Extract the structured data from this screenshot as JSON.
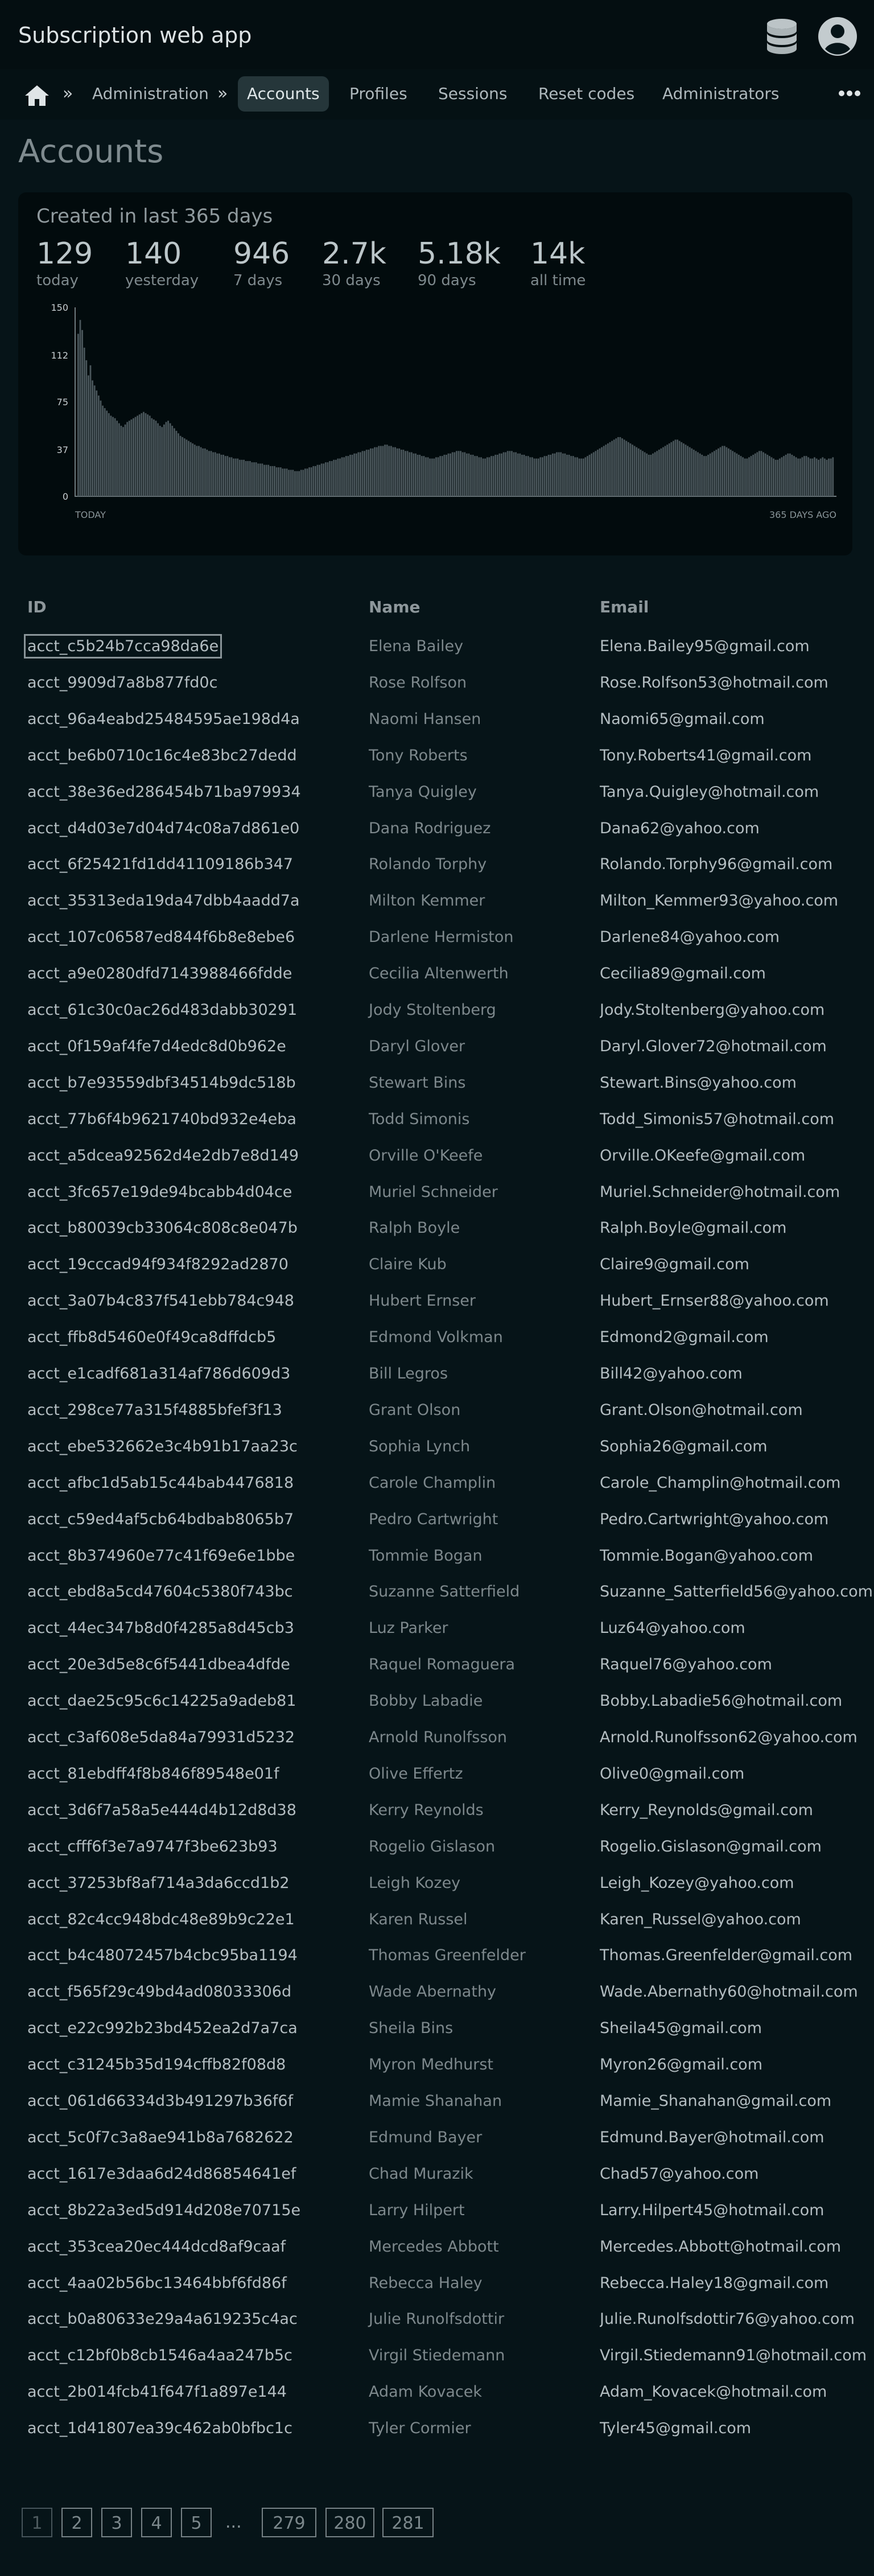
{
  "app": {
    "title": "Subscription web app"
  },
  "nav": {
    "separator": "»",
    "breadcrumb_admin": "Administration",
    "items": [
      {
        "label": "Accounts",
        "active": true
      },
      {
        "label": "Profiles"
      },
      {
        "label": "Sessions"
      },
      {
        "label": "Reset codes"
      },
      {
        "label": "Administrators"
      }
    ]
  },
  "page": {
    "title": "Accounts"
  },
  "stats": {
    "heading": "Created in last 365 days",
    "items": [
      {
        "value": "129",
        "label": "today"
      },
      {
        "value": "140",
        "label": "yesterday"
      },
      {
        "value": "946",
        "label": "7 days"
      },
      {
        "value": "2.7k",
        "label": "30 days"
      },
      {
        "value": "5.18k",
        "label": "90 days"
      },
      {
        "value": "14k",
        "label": "all time"
      }
    ]
  },
  "chart_data": {
    "type": "bar",
    "title": "",
    "x_start_label": "TODAY",
    "x_end_label": "365 DAYS AGO",
    "ylim": [
      0,
      150
    ],
    "y_ticks": [
      "150",
      "112",
      "75",
      "37",
      "0"
    ],
    "values": [
      129,
      140,
      132,
      118,
      108,
      96,
      104,
      92,
      88,
      84,
      80,
      76,
      72,
      70,
      68,
      66,
      64,
      63,
      62,
      60,
      58,
      56,
      55,
      57,
      59,
      60,
      61,
      62,
      63,
      64,
      65,
      66,
      67,
      66,
      65,
      64,
      62,
      61,
      60,
      58,
      56,
      55,
      57,
      59,
      60,
      58,
      56,
      54,
      52,
      50,
      48,
      47,
      46,
      45,
      44,
      43,
      42,
      41,
      40,
      40,
      39,
      38,
      38,
      37,
      36,
      36,
      35,
      35,
      34,
      34,
      33,
      33,
      32,
      32,
      31,
      31,
      30,
      30,
      30,
      29,
      29,
      29,
      28,
      28,
      28,
      27,
      27,
      27,
      26,
      26,
      26,
      25,
      25,
      25,
      24,
      24,
      24,
      23,
      23,
      23,
      22,
      22,
      22,
      21,
      21,
      21,
      20,
      20,
      20,
      21,
      21,
      22,
      22,
      23,
      23,
      24,
      24,
      25,
      25,
      26,
      26,
      27,
      27,
      28,
      28,
      29,
      29,
      30,
      30,
      31,
      31,
      32,
      32,
      33,
      33,
      34,
      34,
      35,
      35,
      36,
      36,
      37,
      37,
      38,
      38,
      39,
      39,
      40,
      40,
      40,
      41,
      41,
      40,
      40,
      39,
      39,
      38,
      38,
      37,
      37,
      36,
      36,
      35,
      35,
      34,
      34,
      33,
      33,
      32,
      32,
      31,
      31,
      30,
      30,
      30,
      31,
      31,
      32,
      32,
      33,
      33,
      34,
      34,
      35,
      35,
      36,
      36,
      36,
      35,
      35,
      34,
      34,
      33,
      33,
      32,
      32,
      31,
      31,
      30,
      30,
      31,
      31,
      32,
      32,
      33,
      33,
      34,
      34,
      35,
      35,
      36,
      36,
      36,
      35,
      35,
      34,
      34,
      33,
      33,
      32,
      32,
      31,
      31,
      30,
      30,
      30,
      31,
      31,
      32,
      32,
      33,
      33,
      34,
      34,
      35,
      35,
      35,
      34,
      34,
      33,
      33,
      32,
      32,
      31,
      31,
      30,
      30,
      30,
      31,
      32,
      33,
      34,
      35,
      36,
      37,
      38,
      39,
      40,
      41,
      42,
      43,
      44,
      45,
      46,
      47,
      47,
      46,
      45,
      44,
      43,
      42,
      41,
      40,
      39,
      38,
      37,
      36,
      35,
      34,
      33,
      33,
      34,
      35,
      36,
      37,
      38,
      39,
      40,
      41,
      42,
      43,
      44,
      45,
      45,
      44,
      43,
      42,
      41,
      40,
      39,
      38,
      37,
      36,
      35,
      34,
      33,
      32,
      32,
      33,
      34,
      35,
      36,
      37,
      38,
      39,
      40,
      40,
      39,
      38,
      37,
      36,
      35,
      34,
      33,
      32,
      31,
      30,
      30,
      31,
      32,
      33,
      34,
      35,
      36,
      36,
      35,
      34,
      33,
      32,
      31,
      30,
      29,
      29,
      30,
      31,
      32,
      33,
      34,
      34,
      33,
      32,
      31,
      30,
      30,
      31,
      32,
      32,
      31,
      30,
      30,
      31,
      30,
      29,
      30,
      31,
      30,
      29,
      30,
      30,
      31
    ]
  },
  "table": {
    "headers": {
      "id": "ID",
      "name": "Name",
      "email": "Email"
    },
    "rows": [
      {
        "id": "acct_c5b24b7cca98da6e",
        "name": "Elena Bailey",
        "email": "Elena.Bailey95@gmail.com"
      },
      {
        "id": "acct_9909d7a8b877fd0c",
        "name": "Rose Rolfson",
        "email": "Rose.Rolfson53@hotmail.com"
      },
      {
        "id": "acct_96a4eabd25484595ae198d4a",
        "name": "Naomi Hansen",
        "email": "Naomi65@gmail.com"
      },
      {
        "id": "acct_be6b0710c16c4e83bc27dedd",
        "name": "Tony Roberts",
        "email": "Tony.Roberts41@gmail.com"
      },
      {
        "id": "acct_38e36ed286454b71ba979934",
        "name": "Tanya Quigley",
        "email": "Tanya.Quigley@hotmail.com"
      },
      {
        "id": "acct_d4d03e7d04d74c08a7d861e0",
        "name": "Dana Rodriguez",
        "email": "Dana62@yahoo.com"
      },
      {
        "id": "acct_6f25421fd1dd41109186b347",
        "name": "Rolando Torphy",
        "email": "Rolando.Torphy96@gmail.com"
      },
      {
        "id": "acct_35313eda19da47dbb4aadd7a",
        "name": "Milton Kemmer",
        "email": "Milton_Kemmer93@yahoo.com"
      },
      {
        "id": "acct_107c06587ed844f6b8e8ebe6",
        "name": "Darlene Hermiston",
        "email": "Darlene84@yahoo.com"
      },
      {
        "id": "acct_a9e0280dfd7143988466fdde",
        "name": "Cecilia Altenwerth",
        "email": "Cecilia89@gmail.com"
      },
      {
        "id": "acct_61c30c0ac26d483dabb30291",
        "name": "Jody Stoltenberg",
        "email": "Jody.Stoltenberg@yahoo.com"
      },
      {
        "id": "acct_0f159af4fe7d4edc8d0b962e",
        "name": "Daryl Glover",
        "email": "Daryl.Glover72@hotmail.com"
      },
      {
        "id": "acct_b7e93559dbf34514b9dc518b",
        "name": "Stewart Bins",
        "email": "Stewart.Bins@yahoo.com"
      },
      {
        "id": "acct_77b6f4b9621740bd932e4eba",
        "name": "Todd Simonis",
        "email": "Todd_Simonis57@hotmail.com"
      },
      {
        "id": "acct_a5dcea92562d4e2db7e8d149",
        "name": "Orville O'Keefe",
        "email": "Orville.OKeefe@gmail.com"
      },
      {
        "id": "acct_3fc657e19de94bcabb4d04ce",
        "name": "Muriel Schneider",
        "email": "Muriel.Schneider@hotmail.com"
      },
      {
        "id": "acct_b80039cb33064c808c8e047b",
        "name": "Ralph Boyle",
        "email": "Ralph.Boyle@gmail.com"
      },
      {
        "id": "acct_19cccad94f934f8292ad2870",
        "name": "Claire Kub",
        "email": "Claire9@gmail.com"
      },
      {
        "id": "acct_3a07b4c837f541ebb784c948",
        "name": "Hubert Ernser",
        "email": "Hubert_Ernser88@yahoo.com"
      },
      {
        "id": "acct_ffb8d5460e0f49ca8dffdcb5",
        "name": "Edmond Volkman",
        "email": "Edmond2@gmail.com"
      },
      {
        "id": "acct_e1cadf681a314af786d609d3",
        "name": "Bill Legros",
        "email": "Bill42@yahoo.com"
      },
      {
        "id": "acct_298ce77a315f4885bfef3f13",
        "name": "Grant Olson",
        "email": "Grant.Olson@hotmail.com"
      },
      {
        "id": "acct_ebe532662e3c4b91b17aa23c",
        "name": "Sophia Lynch",
        "email": "Sophia26@gmail.com"
      },
      {
        "id": "acct_afbc1d5ab15c44bab4476818",
        "name": "Carole Champlin",
        "email": "Carole_Champlin@hotmail.com"
      },
      {
        "id": "acct_c59ed4af5cb64bdbab8065b7",
        "name": "Pedro Cartwright",
        "email": "Pedro.Cartwright@yahoo.com"
      },
      {
        "id": "acct_8b374960e77c41f69e6e1bbe",
        "name": "Tommie Bogan",
        "email": "Tommie.Bogan@yahoo.com"
      },
      {
        "id": "acct_ebd8a5cd47604c5380f743bc",
        "name": "Suzanne Satterfield",
        "email": "Suzanne_Satterfield56@yahoo.com"
      },
      {
        "id": "acct_44ec347b8d0f4285a8d45cb3",
        "name": "Luz Parker",
        "email": "Luz64@yahoo.com"
      },
      {
        "id": "acct_20e3d5e8c6f5441dbea4dfde",
        "name": "Raquel Romaguera",
        "email": "Raquel76@yahoo.com"
      },
      {
        "id": "acct_dae25c95c6c14225a9adeb81",
        "name": "Bobby Labadie",
        "email": "Bobby.Labadie56@hotmail.com"
      },
      {
        "id": "acct_c3af608e5da84a79931d5232",
        "name": "Arnold Runolfsson",
        "email": "Arnold.Runolfsson62@yahoo.com"
      },
      {
        "id": "acct_81ebdff4f8b846f89548e01f",
        "name": "Olive Effertz",
        "email": "Olive0@gmail.com"
      },
      {
        "id": "acct_3d6f7a58a5e444d4b12d8d38",
        "name": "Kerry Reynolds",
        "email": "Kerry_Reynolds@gmail.com"
      },
      {
        "id": "acct_cfff6f3e7a9747f3be623b93",
        "name": "Rogelio Gislason",
        "email": "Rogelio.Gislason@gmail.com"
      },
      {
        "id": "acct_37253bf8af714a3da6ccd1b2",
        "name": "Leigh Kozey",
        "email": "Leigh_Kozey@yahoo.com"
      },
      {
        "id": "acct_82c4cc948bdc48e89b9c22e1",
        "name": "Karen Russel",
        "email": "Karen_Russel@yahoo.com"
      },
      {
        "id": "acct_b4c48072457b4cbc95ba1194",
        "name": "Thomas Greenfelder",
        "email": "Thomas.Greenfelder@gmail.com"
      },
      {
        "id": "acct_f565f29c49bd4ad08033306d",
        "name": "Wade Abernathy",
        "email": "Wade.Abernathy60@hotmail.com"
      },
      {
        "id": "acct_e22c992b23bd452ea2d7a7ca",
        "name": "Sheila Bins",
        "email": "Sheila45@gmail.com"
      },
      {
        "id": "acct_c31245b35d194cffb82f08d8",
        "name": "Myron Medhurst",
        "email": "Myron26@gmail.com"
      },
      {
        "id": "acct_061d66334d3b491297b36f6f",
        "name": "Mamie Shanahan",
        "email": "Mamie_Shanahan@gmail.com"
      },
      {
        "id": "acct_5c0f7c3a8ae941b8a7682622",
        "name": "Edmund Bayer",
        "email": "Edmund.Bayer@hotmail.com"
      },
      {
        "id": "acct_1617e3daa6d24d86854641ef",
        "name": "Chad Murazik",
        "email": "Chad57@yahoo.com"
      },
      {
        "id": "acct_8b22a3ed5d914d208e70715e",
        "name": "Larry Hilpert",
        "email": "Larry.Hilpert45@hotmail.com"
      },
      {
        "id": "acct_353cea20ec444dcd8af9caaf",
        "name": "Mercedes Abbott",
        "email": "Mercedes.Abbott@hotmail.com"
      },
      {
        "id": "acct_4aa02b56bc13464bbf6fd86f",
        "name": "Rebecca Haley",
        "email": "Rebecca.Haley18@gmail.com"
      },
      {
        "id": "acct_b0a80633e29a4a619235c4ac",
        "name": "Julie Runolfsdottir",
        "email": "Julie.Runolfsdottir76@yahoo.com"
      },
      {
        "id": "acct_c12bf0b8cb1546a4aa247b5c",
        "name": "Virgil Stiedemann",
        "email": "Virgil.Stiedemann91@hotmail.com"
      },
      {
        "id": "acct_2b014fcb41f647f1a897e144",
        "name": "Adam Kovacek",
        "email": "Adam_Kovacek@hotmail.com"
      },
      {
        "id": "acct_1d41807ea39c462ab0bfbc1c",
        "name": "Tyler Cormier",
        "email": "Tyler45@gmail.com"
      }
    ]
  },
  "pagination": {
    "current": "1",
    "pages": [
      "1",
      "2",
      "3",
      "4",
      "5",
      "279",
      "280",
      "281"
    ],
    "ellipsis": "..."
  },
  "colors": {
    "background": "#061418",
    "header": "#040e11",
    "panel": "#020b0d",
    "active_tab": "#25363a",
    "chart_bar": "#4a565b"
  },
  "icons": {
    "home": "home-icon",
    "database": "database-icon",
    "user": "user-circle-icon",
    "more": "more-horizontal-icon"
  }
}
